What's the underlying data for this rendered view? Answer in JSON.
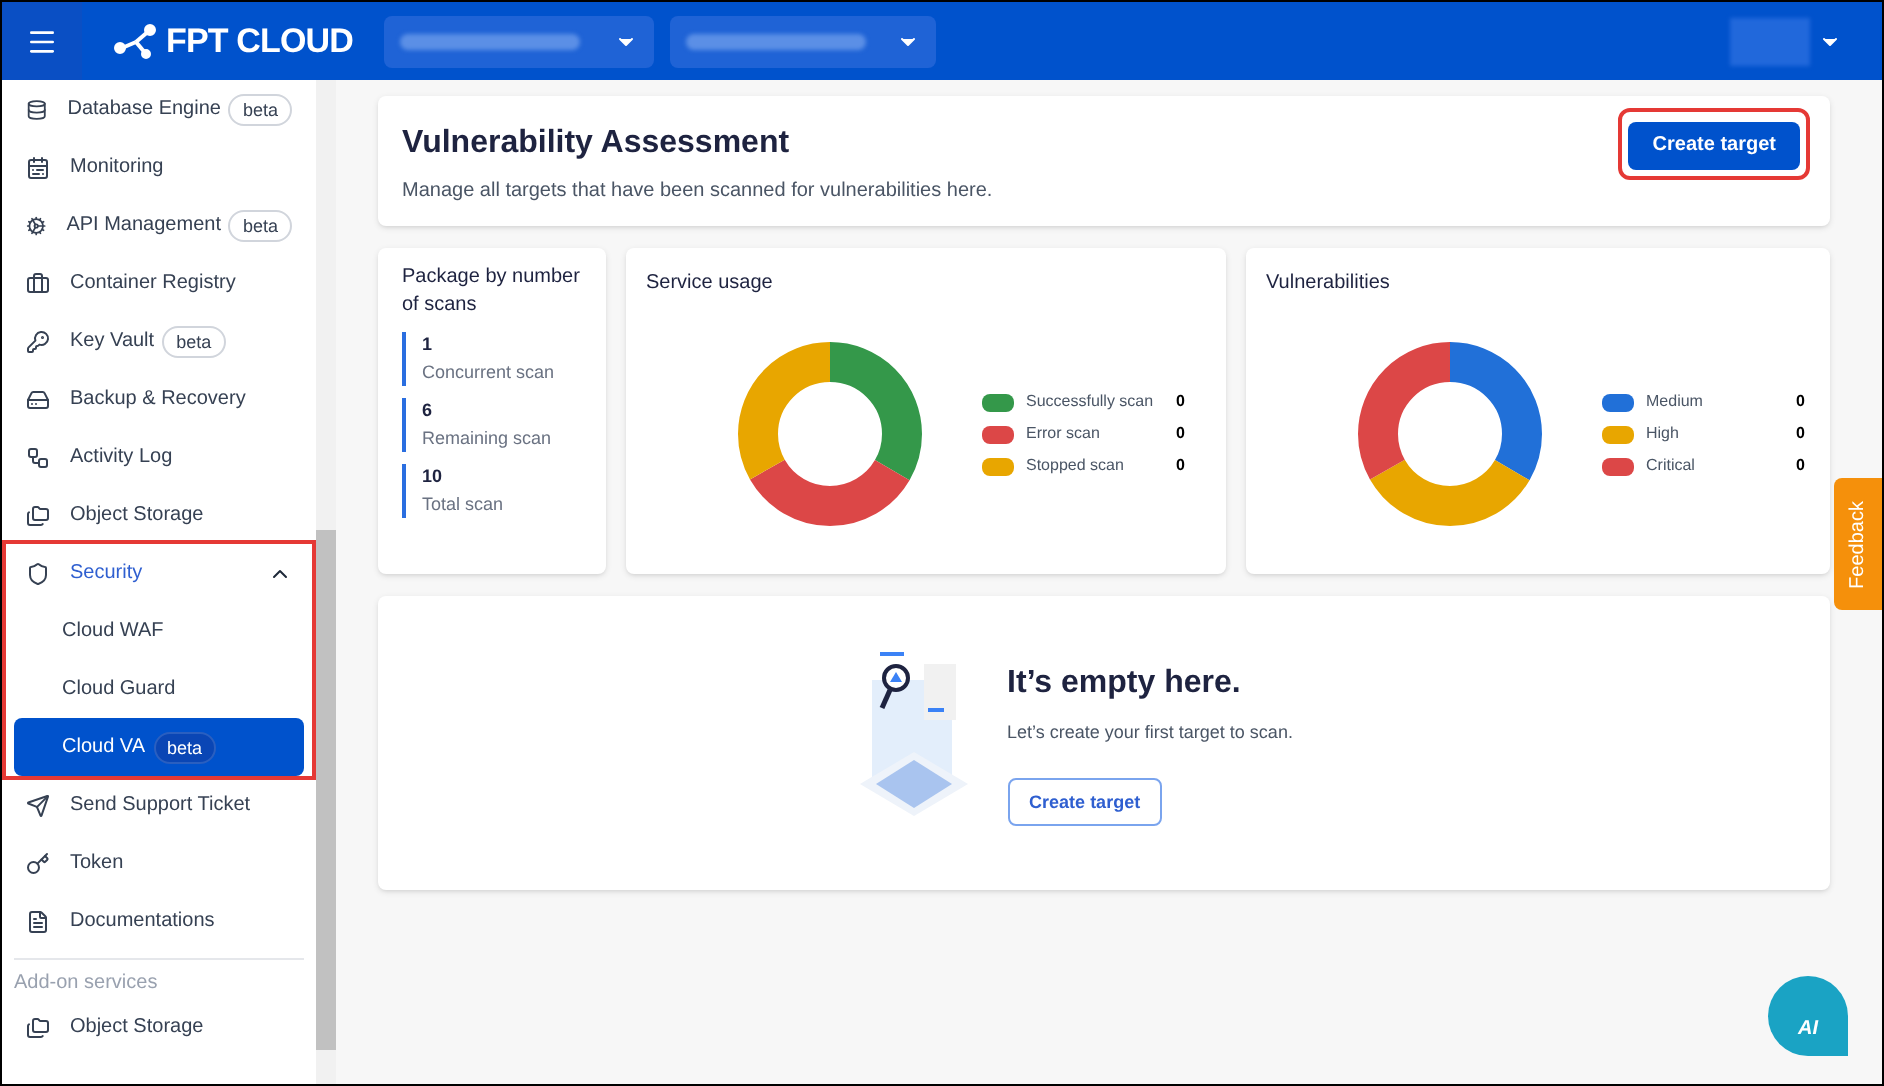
{
  "header": {
    "logo": "FPT CLOUD"
  },
  "sidebar": {
    "items": [
      {
        "label": "Database Engine",
        "badge": "beta",
        "selected": false
      },
      {
        "label": "Monitoring",
        "selected": false
      },
      {
        "label": "API Management",
        "badge": "beta",
        "selected": false
      },
      {
        "label": "Container Registry",
        "selected": false
      },
      {
        "label": "Key Vault",
        "badge": "beta",
        "selected": false
      },
      {
        "label": "Backup & Recovery",
        "selected": false
      },
      {
        "label": "Activity Log",
        "selected": false
      },
      {
        "label": "Object Storage",
        "selected": false
      },
      {
        "label": "Security",
        "selected": false,
        "active": true,
        "expanded": true,
        "highlighted": true,
        "children": [
          {
            "label": "Cloud WAF",
            "selected": false
          },
          {
            "label": "Cloud Guard",
            "selected": false
          },
          {
            "label": "Cloud VA",
            "badge": "beta",
            "selected": true
          }
        ]
      },
      {
        "label": "Send Support Ticket",
        "selected": false
      },
      {
        "label": "Token",
        "selected": false
      },
      {
        "label": "Documentations",
        "selected": false
      }
    ],
    "section": {
      "title": "Add-on services",
      "items": [
        {
          "label": "Object Storage",
          "selected": false
        }
      ]
    }
  },
  "page": {
    "title": "Vulnerability Assessment",
    "subtitle": "Manage all targets that have been scanned for vulnerabilities here.",
    "create_button": {
      "label": "Create target",
      "highlighted": true
    }
  },
  "package": {
    "title": "Package by number of scans",
    "stats": [
      {
        "value": "1",
        "label": "Concurrent scan"
      },
      {
        "value": "6",
        "label": "Remaining scan"
      },
      {
        "value": "10",
        "label": "Total scan"
      }
    ]
  },
  "service_usage": {
    "title": "Service usage",
    "legend": [
      {
        "label": "Successfully scan",
        "value": "0",
        "color": "#34984a"
      },
      {
        "label": "Error scan",
        "value": "0",
        "color": "#dc4747"
      },
      {
        "label": "Stopped scan",
        "value": "0",
        "color": "#e8a600"
      }
    ]
  },
  "vulnerabilities": {
    "title": "Vulnerabilities",
    "legend": [
      {
        "label": "Medium",
        "value": "0",
        "color": "#2170d8"
      },
      {
        "label": "High",
        "value": "0",
        "color": "#e8a600"
      },
      {
        "label": "Critical",
        "value": "0",
        "color": "#dc4747"
      }
    ]
  },
  "empty_state": {
    "title": "It’s empty here.",
    "text": "Let’s create your first target to scan.",
    "button": "Create target"
  },
  "feedback_tab": "Feedback",
  "ai_button": "AI"
}
